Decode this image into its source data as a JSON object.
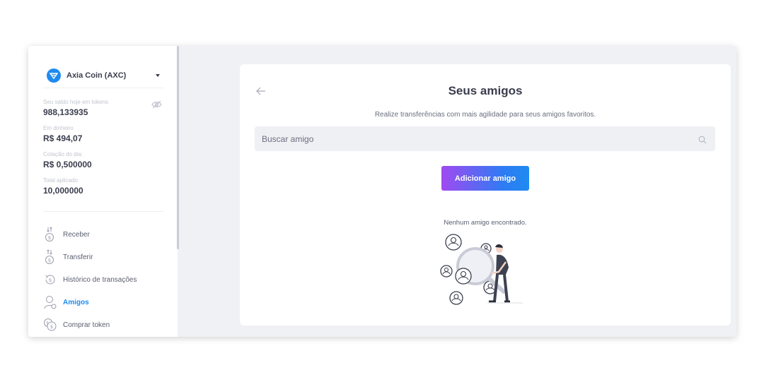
{
  "sidebar": {
    "coin": {
      "name": "Axia Coin (AXC)",
      "logo_color": "#1e8bf0"
    },
    "stats": [
      {
        "label": "Seu saldo hoje em tokens",
        "value": "988,133935"
      },
      {
        "label": "Em dinheiro",
        "value": "R$ 494,07"
      },
      {
        "label": "Cotação do dia:",
        "value": "R$ 0,500000"
      },
      {
        "label": "Total aplicado",
        "value": "10,000000"
      }
    ],
    "nav": [
      {
        "label": "Receber",
        "icon": "receive-icon"
      },
      {
        "label": "Transferir",
        "icon": "transfer-icon"
      },
      {
        "label": "Histórico de transações",
        "icon": "history-icon"
      },
      {
        "label": "Amigos",
        "icon": "friends-icon",
        "active": true
      },
      {
        "label": "Comprar token",
        "icon": "coins-icon"
      }
    ]
  },
  "main": {
    "title": "Seus amigos",
    "subtitle": "Realize transferências com mais agilidade para seus amigos favoritos.",
    "search": {
      "placeholder": "Buscar amigo",
      "value": ""
    },
    "add_button": "Adicionar amigo",
    "empty_message": "Nenhum amigo encontrado."
  },
  "colors": {
    "accent": "#1e8bf0",
    "button_gradient_start": "#a04af0",
    "button_gradient_end": "#1e8bf0",
    "background": "#f0f1f5"
  }
}
